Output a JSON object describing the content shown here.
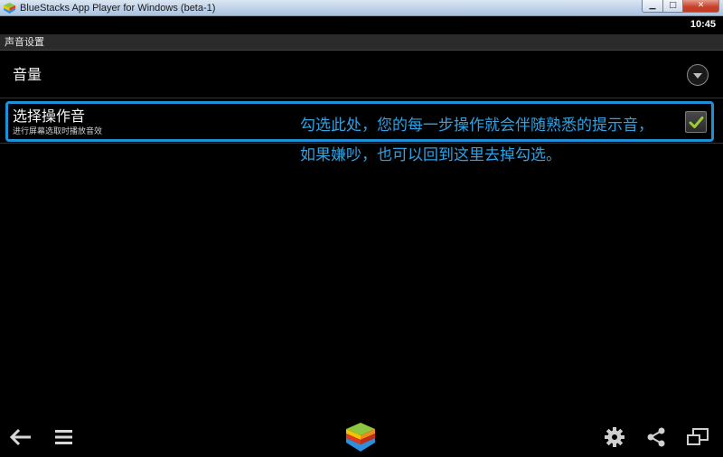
{
  "window": {
    "title": "BlueStacks App Player for Windows (beta-1)",
    "minimize": "▁",
    "maximize": "□",
    "close": "✕"
  },
  "status": {
    "clock": "10:45"
  },
  "actionbar": {
    "title": "声音设置"
  },
  "settings": {
    "volume_label": "音量",
    "selection_sound": {
      "title": "选择操作音",
      "summary": "进行屏幕选取时播放音效",
      "checked": true
    }
  },
  "annotation": {
    "line1": "勾选此处，您的每一步操作就会伴随熟悉的提示音，",
    "line2": "如果嫌吵，也可以回到这里去掉勾选。"
  },
  "colors": {
    "highlight": "#1e90d8",
    "annotation_text": "#2fa2e4",
    "checkmark": "#9acd32"
  },
  "icons": {
    "back": "back-arrow-icon",
    "menu": "menu-icon",
    "home": "bluestacks-home-icon",
    "settings": "gear-icon",
    "share": "share-icon",
    "screen": "screen-rotate-icon"
  }
}
